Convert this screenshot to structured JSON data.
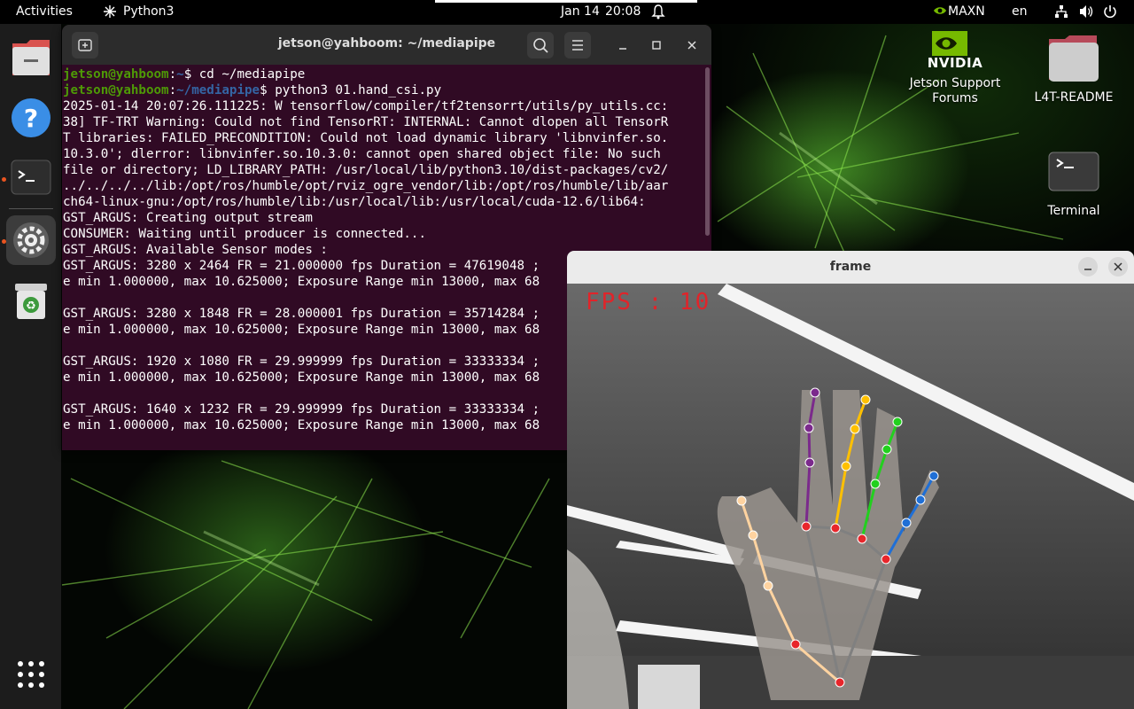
{
  "topbar": {
    "activities": "Activities",
    "app_name": "Python3",
    "date": "Jan 14",
    "time": "20:08",
    "power_mode": "MAXN",
    "language": "en"
  },
  "desktop": {
    "nvidia_label_line1": "Jetson Support",
    "nvidia_label_line2": "Forums",
    "nvidia_logo_text": "NVIDIA",
    "readme_label": "L4T-README",
    "terminal_label": "Terminal"
  },
  "terminal": {
    "title": "jetson@yahboom: ~/mediapipe",
    "lines": [
      {
        "user": "jetson@yahboom",
        "sep": ":",
        "path": "~",
        "cmd": "$ cd ~/mediapipe"
      },
      {
        "user": "jetson@yahboom",
        "sep": ":",
        "path": "~/mediapipe",
        "cmd": "$ python3 01.hand_csi.py"
      },
      {
        "text": "2025-01-14 20:07:26.111225: W tensorflow/compiler/tf2tensorrt/utils/py_utils.cc:"
      },
      {
        "text": "38] TF-TRT Warning: Could not find TensorRT: INTERNAL: Cannot dlopen all TensorR"
      },
      {
        "text": "T libraries: FAILED_PRECONDITION: Could not load dynamic library 'libnvinfer.so."
      },
      {
        "text": "10.3.0'; dlerror: libnvinfer.so.10.3.0: cannot open shared object file: No such"
      },
      {
        "text": "file or directory; LD_LIBRARY_PATH: /usr/local/lib/python3.10/dist-packages/cv2/"
      },
      {
        "text": "../../../../lib:/opt/ros/humble/opt/rviz_ogre_vendor/lib:/opt/ros/humble/lib/aar"
      },
      {
        "text": "ch64-linux-gnu:/opt/ros/humble/lib:/usr/local/lib:/usr/local/cuda-12.6/lib64:"
      },
      {
        "text": "GST_ARGUS: Creating output stream"
      },
      {
        "text": "CONSUMER: Waiting until producer is connected..."
      },
      {
        "text": "GST_ARGUS: Available Sensor modes :"
      },
      {
        "text": "GST_ARGUS: 3280 x 2464 FR = 21.000000 fps Duration = 47619048 ;"
      },
      {
        "text": "e min 1.000000, max 10.625000; Exposure Range min 13000, max 68"
      },
      {
        "text": ""
      },
      {
        "text": "GST_ARGUS: 3280 x 1848 FR = 28.000001 fps Duration = 35714284 ;"
      },
      {
        "text": "e min 1.000000, max 10.625000; Exposure Range min 13000, max 68"
      },
      {
        "text": ""
      },
      {
        "text": "GST_ARGUS: 1920 x 1080 FR = 29.999999 fps Duration = 33333334 ;"
      },
      {
        "text": "e min 1.000000, max 10.625000; Exposure Range min 13000, max 68"
      },
      {
        "text": ""
      },
      {
        "text": "GST_ARGUS: 1640 x 1232 FR = 29.999999 fps Duration = 33333334 ;"
      },
      {
        "text": "e min 1.000000, max 10.625000; Exposure Range min 13000, max 68"
      }
    ]
  },
  "frame_window": {
    "title": "frame",
    "fps_text": "FPS : 10",
    "fps_color": "#e0242a"
  },
  "colors": {
    "terminal_bg": "#300a24",
    "prompt_user": "#4e9a06",
    "prompt_path": "#3465a4",
    "accent": "#e95420",
    "landmark_joint": "#e8262b",
    "thumb": "#ffd3a0",
    "index": "#7b2a8c",
    "middle": "#ffc000",
    "ring": "#22d01e",
    "pinky": "#1f6fd6",
    "palm": "#808080"
  }
}
